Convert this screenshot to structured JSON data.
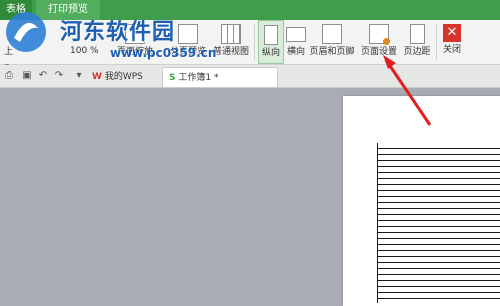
{
  "titlebar": {
    "app_tab": "表格",
    "preview_tab": "打印预览"
  },
  "left": {
    "row1": "上",
    "row2": "F"
  },
  "zoom": {
    "value": "100 %"
  },
  "ribbon": {
    "page_zoom": "页面缩放",
    "page_break": "分页预览",
    "normal_view": "普通视图",
    "portrait": "纵向",
    "landscape": "横向",
    "header_footer": "页眉和页脚",
    "page_setup": "页面设置",
    "margins": "页边距",
    "close": "关闭"
  },
  "tabs": {
    "wps": "我的WPS",
    "workbook": "工作簿1 *"
  },
  "watermark": {
    "text": "河东软件园",
    "url": "www.pc0359.cn"
  },
  "colors": {
    "accent": "#3f9e4a",
    "arrow": "#e02020",
    "close": "#d9342b"
  }
}
